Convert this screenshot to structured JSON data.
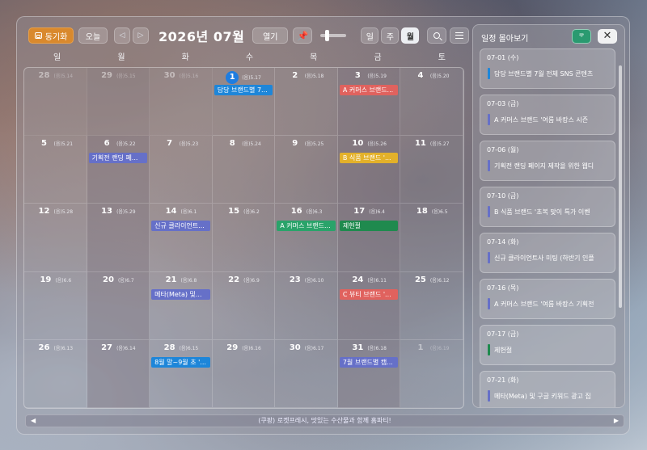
{
  "toolbar": {
    "sync_label": "동기화",
    "today_label": "오늘",
    "prev_arrow": "◁",
    "next_arrow": "▷",
    "month_title": "2026년 07월",
    "open_label": "열기",
    "pin_glyph": "📌",
    "views": [
      "일",
      "주",
      "월"
    ],
    "active_view": "월"
  },
  "weekdays": [
    "일",
    "월",
    "화",
    "수",
    "목",
    "금",
    "토"
  ],
  "weeks": [
    [
      {
        "day": "28",
        "lunar": "(음)5.14",
        "other": true
      },
      {
        "day": "29",
        "lunar": "(음)5.15",
        "other": true
      },
      {
        "day": "30",
        "lunar": "(음)5.16",
        "other": true
      },
      {
        "day": "1",
        "lunar": "(음)5.17",
        "today": true,
        "event": {
          "title": "담당 브랜드별 7...",
          "color": "#1e86d9"
        }
      },
      {
        "day": "2",
        "lunar": "(음)5.18"
      },
      {
        "day": "3",
        "lunar": "(음)5.19",
        "event": {
          "title": "A 커머스 브랜드...",
          "color": "#e0625e"
        }
      },
      {
        "day": "4",
        "lunar": "(음)5.20"
      }
    ],
    [
      {
        "day": "5",
        "lunar": "(음)5.21"
      },
      {
        "day": "6",
        "lunar": "(음)5.22",
        "event": {
          "title": "기획전 랜딩 페...",
          "color": "#6670c8"
        }
      },
      {
        "day": "7",
        "lunar": "(음)5.23"
      },
      {
        "day": "8",
        "lunar": "(음)5.24"
      },
      {
        "day": "9",
        "lunar": "(음)5.25"
      },
      {
        "day": "10",
        "lunar": "(음)5.26",
        "event": {
          "title": "B 식품 브랜드 '...",
          "color": "#e3b12a"
        }
      },
      {
        "day": "11",
        "lunar": "(음)5.27"
      }
    ],
    [
      {
        "day": "12",
        "lunar": "(음)5.28"
      },
      {
        "day": "13",
        "lunar": "(음)5.29"
      },
      {
        "day": "14",
        "lunar": "(음)6.1",
        "event": {
          "title": "신규 클라이언트...",
          "color": "#6670c8"
        }
      },
      {
        "day": "15",
        "lunar": "(음)6.2"
      },
      {
        "day": "16",
        "lunar": "(음)6.3",
        "event": {
          "title": "A 커머스 브랜드...",
          "color": "#2aa36a"
        }
      },
      {
        "day": "17",
        "lunar": "(음)6.4",
        "event": {
          "title": "제헌절",
          "color": "#1f8a4e"
        }
      },
      {
        "day": "18",
        "lunar": "(음)6.5"
      }
    ],
    [
      {
        "day": "19",
        "lunar": "(음)6.6"
      },
      {
        "day": "20",
        "lunar": "(음)6.7"
      },
      {
        "day": "21",
        "lunar": "(음)6.8",
        "event": {
          "title": "메타(Meta) 및...",
          "color": "#6670c8"
        }
      },
      {
        "day": "22",
        "lunar": "(음)6.9"
      },
      {
        "day": "23",
        "lunar": "(음)6.10"
      },
      {
        "day": "24",
        "lunar": "(음)6.11",
        "event": {
          "title": "C 뷰티 브랜드 '...",
          "color": "#e0625e"
        }
      },
      {
        "day": "25",
        "lunar": "(음)6.12"
      }
    ],
    [
      {
        "day": "26",
        "lunar": "(음)6.13"
      },
      {
        "day": "27",
        "lunar": "(음)6.14"
      },
      {
        "day": "28",
        "lunar": "(음)6.15",
        "event": {
          "title": "8월 말~9월 초 '...",
          "color": "#1e86d9"
        }
      },
      {
        "day": "29",
        "lunar": "(음)6.16"
      },
      {
        "day": "30",
        "lunar": "(음)6.17"
      },
      {
        "day": "31",
        "lunar": "(음)6.18",
        "event": {
          "title": "7월 브랜드별 캠...",
          "color": "#6670c8"
        }
      },
      {
        "day": "1",
        "lunar": "(음)6.19",
        "other": true
      }
    ]
  ],
  "panel": {
    "title": "일정 몰아보기",
    "toggle_label": "ᄛ",
    "close_label": "✕",
    "items": [
      {
        "date": "07-01 (수)",
        "title": "담당 브랜드별 7월 전체 SNS 콘텐츠",
        "color": "#1e86d9"
      },
      {
        "date": "07-03 (금)",
        "title": "A 커머스 브랜드 '여름 바캉스 시즌",
        "color": "#6670c8"
      },
      {
        "date": "07-06 (월)",
        "title": "기획전 랜딩 페이지 제작을 위한 웹디",
        "color": "#6670c8"
      },
      {
        "date": "07-10 (금)",
        "title": "B 식품 브랜드 '초복 맞이 특가 이벤",
        "color": "#6670c8"
      },
      {
        "date": "07-14 (화)",
        "title": "신규 클라이언트사 미팅 (하반기 인플",
        "color": "#6670c8"
      },
      {
        "date": "07-16 (목)",
        "title": "A 커머스 브랜드 '여름 바캉스 기획전",
        "color": "#6670c8"
      },
      {
        "date": "07-17 (금)",
        "title": "제헌절",
        "color": "#1f8a4e"
      },
      {
        "date": "07-21 (화)",
        "title": "메타(Meta) 및 구글 키워드 광고 집",
        "color": "#6670c8"
      }
    ]
  },
  "ticker": {
    "text": "(쿠팡) 로켓프레시, 맛있는 수산물과 함께 홈파티!",
    "left_arrow": "◀",
    "right_arrow": "▶"
  }
}
